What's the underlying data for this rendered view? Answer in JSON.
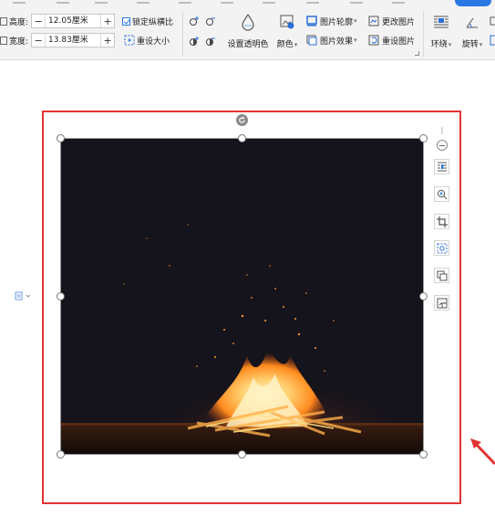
{
  "ribbon": {
    "height_label": "高度:",
    "height_value": "12.05厘米",
    "width_label": "宽度:",
    "width_value": "13.83厘米",
    "minus": "−",
    "plus": "+",
    "lock_ratio_label": "锁定纵横比",
    "lock_ratio_checked": true,
    "reset_size_label": "重设大小",
    "set_transparent_label": "设置透明色",
    "color_label": "颜色",
    "picture_outline_label": "图片轮廓",
    "picture_effects_label": "图片效果",
    "change_picture_label": "更改图片",
    "reset_picture_label": "重设图片",
    "wrap_label": "环绕",
    "rotate_label": "旋转",
    "caret": "▾"
  },
  "accent_colors": {
    "selection_frame": "#e23434",
    "active_tab": "#2b78e4",
    "photo_background": "#14121a"
  },
  "side_toolbar": [
    {
      "icon": "layout-options-icon"
    },
    {
      "icon": "zoom-in-icon"
    },
    {
      "icon": "crop-icon"
    },
    {
      "icon": "cutout-icon"
    },
    {
      "icon": "picture-replace-icon"
    },
    {
      "icon": "picture-compress-icon"
    }
  ]
}
